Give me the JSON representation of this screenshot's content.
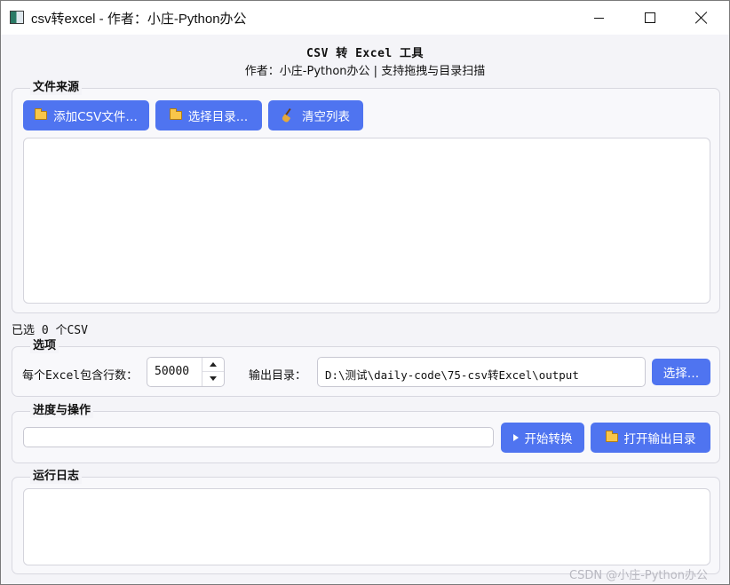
{
  "window": {
    "title": "csv转excel - 作者：小庄-Python办公",
    "controls": {
      "minimize": "minimize-icon",
      "maximize": "maximize-icon",
      "close": "close-icon"
    }
  },
  "header": {
    "title": "CSV 转 Excel 工具",
    "subtitle": "作者：小庄-Python办公  |  支持拖拽与目录扫描"
  },
  "file_source": {
    "title": "文件来源",
    "add_csv": "添加CSV文件…",
    "select_dir": "选择目录…",
    "clear_list": "清空列表",
    "files": [],
    "selected_count_label": "已选 0 个CSV"
  },
  "options": {
    "title": "选项",
    "rows_label": "每个Excel包含行数：",
    "rows_value": "50000",
    "output_label": "输出目录：",
    "output_path": "D:\\测试\\daily-code\\75-csv转Excel\\output",
    "choose_button": "选择…"
  },
  "progress": {
    "title": "进度与操作",
    "value": 0,
    "start_button": "开始转换",
    "open_output_button": "打开输出目录"
  },
  "log": {
    "title": "运行日志",
    "content": ""
  },
  "watermark": "CSDN @小庄-Python办公",
  "colors": {
    "accent": "#4f74f0",
    "background": "#f4f4f8",
    "folder": "#f8c64a"
  }
}
